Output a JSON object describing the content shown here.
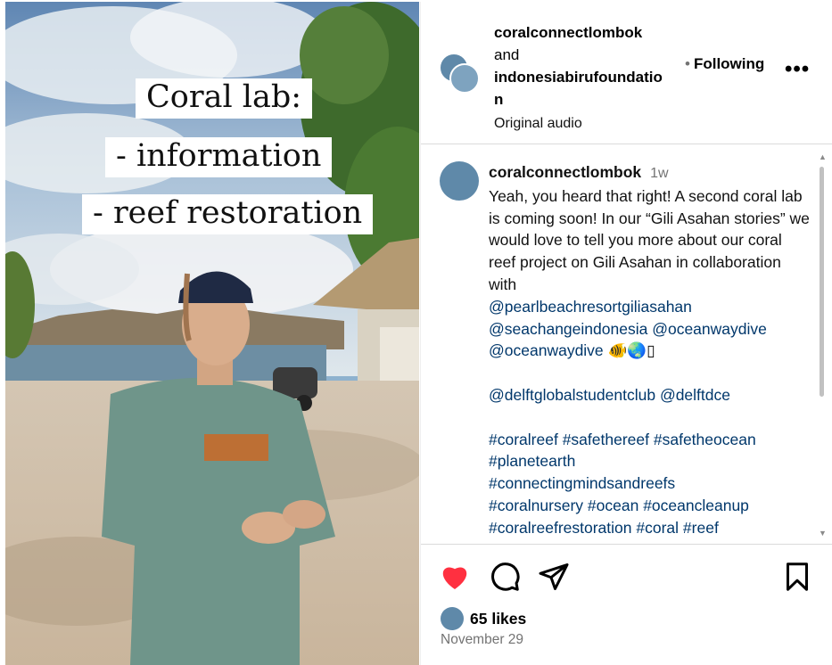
{
  "video": {
    "captions": [
      "Coral lab:",
      "- information",
      "- reef restoration"
    ]
  },
  "header": {
    "user1": "coralconnectlombok",
    "and_text": "and",
    "user2": "indonesiabirufoundatio",
    "user2_wrap": "n",
    "audio": "Original audio",
    "following_dot": "•",
    "following": "Following",
    "more": "•••"
  },
  "post": {
    "username": "coralconnectlombok",
    "time": "1w",
    "text": "Yeah, you heard that right! A second coral lab is coming soon! In our “Gili Asahan stories” we would love to tell you more about our coral reef project on Gili Asahan in collaboration with",
    "mentions": [
      "@pearlbeachresortgiliasahan",
      "@seachangeindonesia",
      "@oceanwaydive",
      "@oceanwaydive"
    ],
    "emojis": "🐠🌏▯",
    "mentions2": [
      "@delftglobalstudentclub",
      "@delftdce"
    ],
    "hashtags": [
      "#coralreef",
      "#safethereef",
      "#safetheocean",
      "#planetearth",
      "#connectingmindsandreefs",
      "#coralnursery",
      "#ocean",
      "#oceancleanup",
      "#coralreefrestoration",
      "#coral",
      "#reef",
      "#..."
    ]
  },
  "actions": {
    "icons": [
      "heart-icon",
      "comment-icon",
      "share-icon",
      "bookmark-icon"
    ],
    "like_color": "#ff3040",
    "likes": "65 likes",
    "date": "November 29"
  },
  "colors": {
    "link": "#00376b",
    "muted": "#737373",
    "border": "#dbdbdb"
  }
}
